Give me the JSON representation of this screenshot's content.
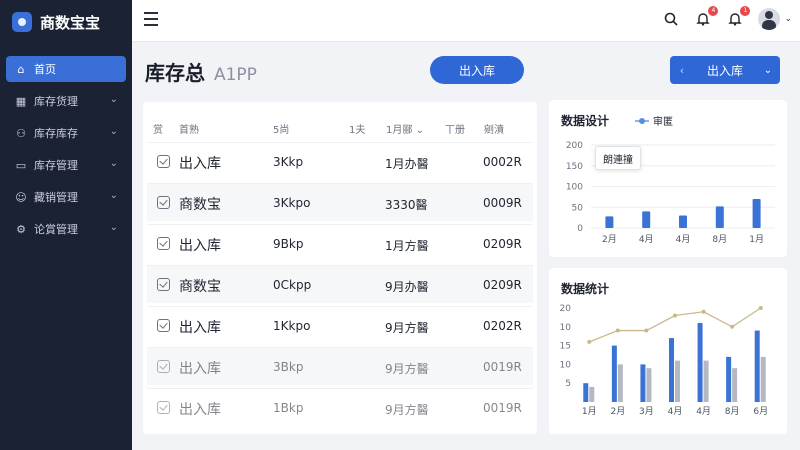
{
  "brand": {
    "name": "商数宝宝"
  },
  "sidebar": {
    "items": [
      {
        "label": "首页",
        "icon": "home-icon",
        "active": true
      },
      {
        "label": "库存货理",
        "icon": "grid-icon"
      },
      {
        "label": "库存库存",
        "icon": "users-icon"
      },
      {
        "label": "库存管理",
        "icon": "box-icon"
      },
      {
        "label": "藏销管理",
        "icon": "user-icon"
      },
      {
        "label": "论賞管理",
        "icon": "gear-icon"
      }
    ]
  },
  "topbar": {
    "notifications": [
      {
        "icon": "bell-icon",
        "badge": "4"
      },
      {
        "icon": "bell-icon",
        "badge": "1"
      }
    ]
  },
  "header": {
    "title": "库存总",
    "subtitle": "A1PP",
    "primary_button": "出入库",
    "split_button": "出入库"
  },
  "table": {
    "columns": [
      "赏",
      "首熟",
      "5尚",
      "1夫",
      "1月郦",
      "丅册",
      "剜濆"
    ],
    "rows": [
      {
        "name": "出入库",
        "qty": "3Kkp",
        "date": "1月办醫",
        "code": "0002R"
      },
      {
        "name": "商数宝",
        "qty": "3Kkpo",
        "date": "3330醫",
        "code": "0009R"
      },
      {
        "name": "出入库",
        "qty": "9Bkp",
        "date": "1月方醫",
        "code": "0209R"
      },
      {
        "name": "商数宝",
        "qty": "0Ckpp",
        "date": "9月办醫",
        "code": "0209R"
      },
      {
        "name": "出入库",
        "qty": "1Kkpo",
        "date": "9月方醫",
        "code": "0202R"
      },
      {
        "name": "出入库",
        "qty": "3Bkp",
        "date": "9月方醫",
        "code": "0019R"
      },
      {
        "name": "出入库",
        "qty": "1Bkp",
        "date": "9月方醫",
        "code": "0019R"
      }
    ]
  },
  "chart1": {
    "title": "数据设计",
    "legend": "审匿",
    "tooltip": "朗連撞"
  },
  "chart2": {
    "title": "数据统计"
  },
  "chart_data": [
    {
      "type": "bar",
      "title": "数据设计",
      "categories": [
        "2月",
        "4月",
        "4月",
        "8月",
        "1月"
      ],
      "values": [
        28,
        40,
        30,
        52,
        70
      ],
      "ylim": [
        0,
        200
      ],
      "yticks": [
        0,
        50,
        100,
        150,
        200
      ],
      "legend": [
        "审匿"
      ],
      "color": "#3b72d6"
    },
    {
      "type": "bar",
      "title": "数据统计",
      "categories": [
        "1月",
        "2月",
        "3月",
        "4月",
        "4月",
        "8月",
        "6月"
      ],
      "series": [
        {
          "values": [
            5,
            15,
            10,
            17,
            21,
            12,
            19
          ],
          "color": "#3b72d6"
        },
        {
          "values": [
            4,
            10,
            9,
            11,
            11,
            9,
            12
          ],
          "color": "#b4b8c2"
        }
      ],
      "line": {
        "values": [
          16,
          19,
          19,
          23,
          24,
          20,
          25
        ],
        "color": "#c9b98a"
      },
      "ylim": [
        0,
        25
      ],
      "yticks": [
        "5",
        "10",
        "15",
        "10",
        "20"
      ]
    }
  ]
}
